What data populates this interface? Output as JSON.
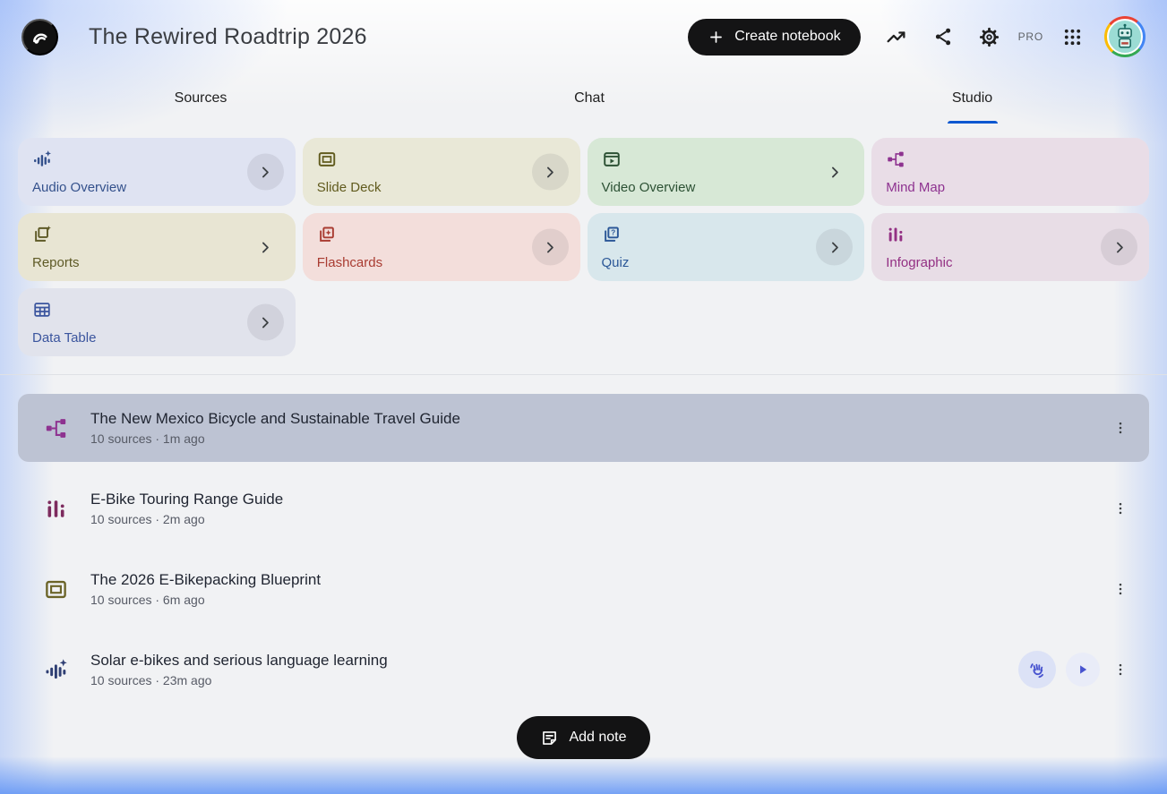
{
  "header": {
    "title": "The Rewired Roadtrip 2026",
    "create_notebook_label": "Create notebook",
    "pro_badge": "PRO"
  },
  "tabs": [
    {
      "label": "Sources",
      "active": false
    },
    {
      "label": "Chat",
      "active": false
    },
    {
      "label": "Studio",
      "active": true
    }
  ],
  "studio_tools": [
    {
      "label": "Audio Overview",
      "icon": "audio-waveform-sparkle-icon",
      "bg": "#dfe3f2",
      "fg": "#34518c",
      "chevron": "circle"
    },
    {
      "label": "Slide Deck",
      "icon": "slide-deck-icon",
      "bg": "#e9e8d7",
      "fg": "#615b1e",
      "chevron": "circle"
    },
    {
      "label": "Video Overview",
      "icon": "video-overview-icon",
      "bg": "#d7e8d6",
      "fg": "#2c5134",
      "chevron": "plain"
    },
    {
      "label": "Mind Map",
      "icon": "mind-map-icon",
      "bg": "#e9dde7",
      "fg": "#8e3290",
      "chevron": "none"
    },
    {
      "label": "Reports",
      "icon": "report-sparkle-icon",
      "bg": "#e8e5d3",
      "fg": "#5e5a26",
      "chevron": "plain"
    },
    {
      "label": "Flashcards",
      "icon": "flashcards-icon",
      "bg": "#f3dedb",
      "fg": "#a93c32",
      "chevron": "circle"
    },
    {
      "label": "Quiz",
      "icon": "quiz-icon",
      "bg": "#d8e7ec",
      "fg": "#2b5797",
      "chevron": "circle"
    },
    {
      "label": "Infographic",
      "icon": "infographic-icon",
      "bg": "#e8dde6",
      "fg": "#933083",
      "chevron": "circle"
    },
    {
      "label": "Data Table",
      "icon": "data-table-icon",
      "bg": "#e1e3ec",
      "fg": "#3b559e",
      "chevron": "circle"
    }
  ],
  "artifacts": [
    {
      "title": "The New Mexico Bicycle and Sustainable Travel Guide",
      "meta": "10 sources · 1m ago",
      "icon": "mind-map-icon",
      "selected": true
    },
    {
      "title": "E-Bike Touring Range Guide",
      "meta": "10 sources · 2m ago",
      "icon": "infographic-icon",
      "selected": false
    },
    {
      "title": "The 2026 E-Bikepacking Blueprint",
      "meta": "10 sources · 6m ago",
      "icon": "slide-deck-icon",
      "selected": false
    },
    {
      "title": "Solar e-bikes and serious language learning",
      "meta": "10 sources · 23m ago",
      "icon": "audio-waveform-icon",
      "selected": false
    }
  ],
  "add_note_label": "Add note",
  "colors": {
    "accent_blue": "#0b57d0",
    "selected_row_bg": "#bdc3d3",
    "pill_black": "#131314",
    "edge_glow_blue": "#6c9bf6",
    "mind_map_purple": "#8e3290",
    "infographic_maroon": "#7d2b5e",
    "slide_olive": "#6b6428",
    "audio_navy": "#2f3f73",
    "action_indigo": "#4753cf"
  }
}
